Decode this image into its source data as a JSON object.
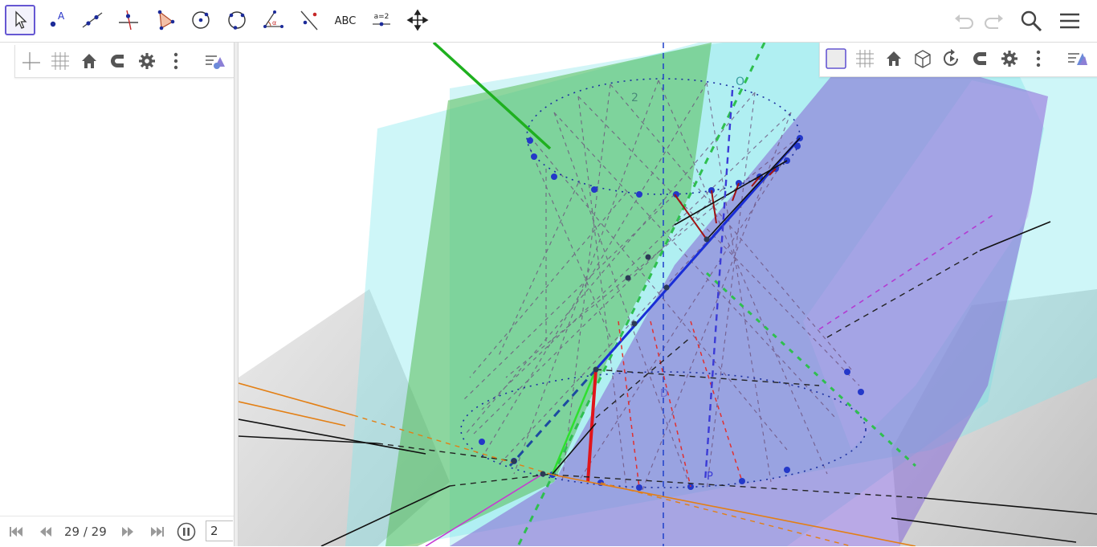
{
  "toolbar": {
    "tools": [
      {
        "id": "move",
        "icon": "arrow-cursor-icon",
        "selected": true
      },
      {
        "id": "point",
        "icon": "point-icon",
        "label": "A"
      },
      {
        "id": "line",
        "icon": "line-through-points-icon"
      },
      {
        "id": "perpendicular",
        "icon": "perpendicular-line-icon"
      },
      {
        "id": "polygon",
        "icon": "polygon-icon"
      },
      {
        "id": "circle",
        "icon": "circle-center-point-icon"
      },
      {
        "id": "circle3",
        "icon": "circle-three-points-icon"
      },
      {
        "id": "angle",
        "icon": "angle-icon",
        "label": "α"
      },
      {
        "id": "reflect",
        "icon": "reflect-line-icon"
      },
      {
        "id": "text",
        "icon": "text-icon",
        "label": "ABC"
      },
      {
        "id": "slider",
        "icon": "slider-icon",
        "label": "a=2"
      },
      {
        "id": "move-view",
        "icon": "move-graphics-view-icon"
      }
    ],
    "right": [
      "undo-icon",
      "redo-icon",
      "search-icon",
      "menu-icon"
    ]
  },
  "algebra_style_bar": [
    "axes-icon",
    "grid-icon",
    "home-icon",
    "magnet-icon",
    "gear-icon",
    "more-vertical-icon",
    "toggle-style-bar-icon"
  ],
  "view3d_style_bar": [
    "background-icon",
    "grid-icon",
    "home-icon",
    "cube-view-icon",
    "rotate-view-icon",
    "magnet-icon",
    "gear-icon",
    "more-vertical-icon",
    "toggle-style-bar-icon"
  ],
  "scene_labels": [
    "2",
    "O",
    "D",
    "P"
  ],
  "playbar": {
    "counter": "29 / 29",
    "step_value": "2",
    "buttons": [
      "skip-first-icon",
      "step-back-icon",
      "step-forward-icon",
      "skip-last-icon",
      "pause-icon"
    ]
  },
  "colors": {
    "accent": "#6557d2",
    "green_plane": "#5cbf5c",
    "cyan_plane": "#7ee8ec",
    "purple_plane": "#8c7fd6",
    "z_axis": "#1f3fc9",
    "red": "#e0151b",
    "orange": "#e37f14",
    "magenta": "#c63ad1"
  }
}
